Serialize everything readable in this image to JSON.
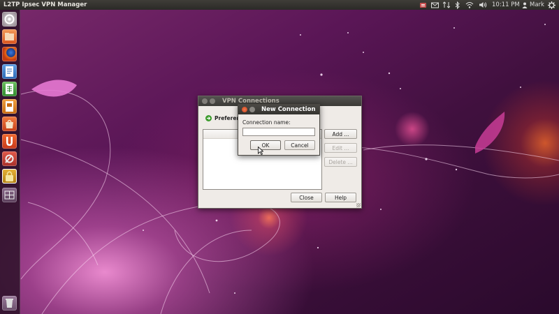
{
  "top_panel": {
    "app_title": "L2TP Ipsec VPN Manager",
    "clock": "10:11 PM",
    "user": "Mark"
  },
  "launcher": {
    "items": [
      {
        "name": "dash-home-icon"
      },
      {
        "name": "files-icon"
      },
      {
        "name": "firefox-icon"
      },
      {
        "name": "writer-icon"
      },
      {
        "name": "calc-icon"
      },
      {
        "name": "impress-icon"
      },
      {
        "name": "software-center-icon"
      },
      {
        "name": "ubuntu-one-icon"
      },
      {
        "name": "system-settings-icon"
      },
      {
        "name": "vpn-manager-icon"
      },
      {
        "name": "workspace-switcher-icon"
      },
      {
        "name": "trash-icon"
      }
    ]
  },
  "vpn_window": {
    "title": "VPN Connections",
    "preferences_label": "Preferen",
    "buttons": {
      "add": "Add ...",
      "edit": "Edit ...",
      "delete": "Delete ...",
      "close": "Close",
      "help": "Help"
    }
  },
  "dialog": {
    "title": "New Connection",
    "connection_name_label": "Connection name:",
    "connection_name_value": "",
    "ok": "OK",
    "cancel": "Cancel"
  }
}
